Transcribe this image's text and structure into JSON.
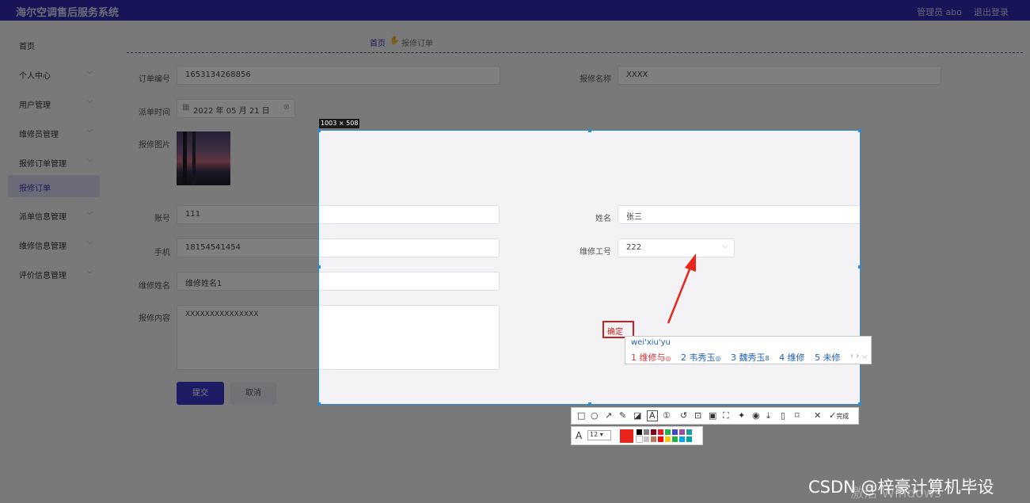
{
  "app": {
    "title": "海尔空调售后服务系统",
    "user": "管理员 abo",
    "logout": "退出登录"
  },
  "sidebar": {
    "items": [
      {
        "label": "首页",
        "chevron": false
      },
      {
        "label": "个人中心",
        "chevron": true
      },
      {
        "label": "用户管理",
        "chevron": true
      },
      {
        "label": "维修员管理",
        "chevron": true
      },
      {
        "label": "报修订单管理",
        "chevron": true
      },
      {
        "label": "报修订单",
        "chevron": false,
        "active": true
      },
      {
        "label": "派单信息管理",
        "chevron": true
      },
      {
        "label": "维修信息管理",
        "chevron": true
      },
      {
        "label": "评价信息管理",
        "chevron": true
      }
    ]
  },
  "breadcrumb": {
    "home": "首页",
    "current": "报修订单"
  },
  "form": {
    "order_no_label": "订单编号",
    "order_no": "1653134268856",
    "repair_name_label": "报修名称",
    "repair_name": "XXXX",
    "dispatch_time_label": "派单时间",
    "dispatch_time": "2022 年 05 月 21 日",
    "photo_label": "报修图片",
    "account_label": "账号",
    "account": "111",
    "name_label": "姓名",
    "name": "张三",
    "phone_label": "手机",
    "phone": "18154541454",
    "tech_id_label": "维修工号",
    "tech_id": "222",
    "tech_name_label": "维修姓名",
    "tech_name": "维修姓名1",
    "content_label": "报修内容",
    "content": "XXXXXXXXXXXXXXX",
    "submit": "提交",
    "cancel": "取消"
  },
  "screenshot_tool": {
    "size_label": "1003 × 508",
    "annotation_text": "确定",
    "done_label": "完成",
    "font_size": "12",
    "current_color": "#e8241b",
    "palette": [
      "#000000",
      "#7f7f7f",
      "#880015",
      "#ed1c24",
      "#22b14c",
      "#3f48cc",
      "#a349a4",
      "#1a9fa0",
      "#ffffff",
      "#c3c3c3",
      "#b97a57",
      "#ff0000",
      "#ffc90e",
      "#22b14c",
      "#00a2e8",
      "#00a2a2"
    ]
  },
  "ime": {
    "pinyin": "wei'xiu'yu",
    "candidates": [
      {
        "text": "1 维修与",
        "mark": "◎"
      },
      {
        "text": "2 韦秀玉",
        "mark": "◎"
      },
      {
        "text": "3 魏秀玉",
        "mark": "8"
      },
      {
        "text": "4 维修",
        "mark": ""
      },
      {
        "text": "5 未修",
        "mark": ""
      }
    ]
  },
  "watermarks": {
    "csdn": "CSDN @梓豪计算机毕设",
    "windows": "激活 Windows"
  }
}
